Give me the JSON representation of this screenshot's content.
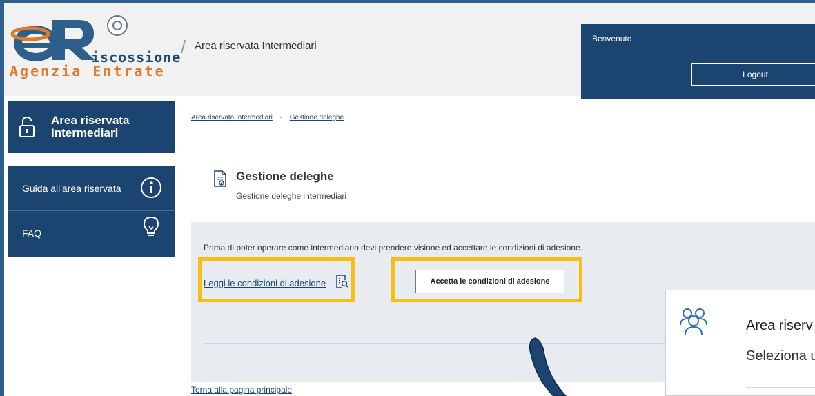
{
  "header": {
    "logo": {
      "riscossione": "iscossione",
      "agenzia": "Agenzia Entrate"
    },
    "separator": "/",
    "title": "Area riservata Intermediari",
    "welcome": "Benvenuto",
    "logout_label": "Logout"
  },
  "sidebar": {
    "area_label": "Area riservata Intermediari",
    "items": [
      {
        "label": "Guida all'area riservata",
        "icon": "info-icon"
      },
      {
        "label": "FAQ",
        "icon": "lightbulb-icon"
      }
    ]
  },
  "breadcrumb": {
    "items": [
      "Area riservata Intermediari",
      "Gestione deleghe"
    ],
    "separator": "-"
  },
  "main": {
    "title": "Gestione deleghe",
    "subtitle": "Gestione deleghe intermediari",
    "conditions_text": "Prima di poter operare come intermediario devi prendere visione ed accettare le condizioni di adesione.",
    "read_link": "Leggi le condizioni di adesione",
    "accept_label": "Accetta le condizioni di adesione",
    "back_link": "Torna alla pagina principale"
  },
  "overlay": {
    "title": "Area riserv",
    "subtitle": "Seleziona u"
  },
  "colors": {
    "brand_blue": "#1c4470",
    "highlight": "#f6bd16",
    "panel_bg": "#e8ecf1"
  }
}
